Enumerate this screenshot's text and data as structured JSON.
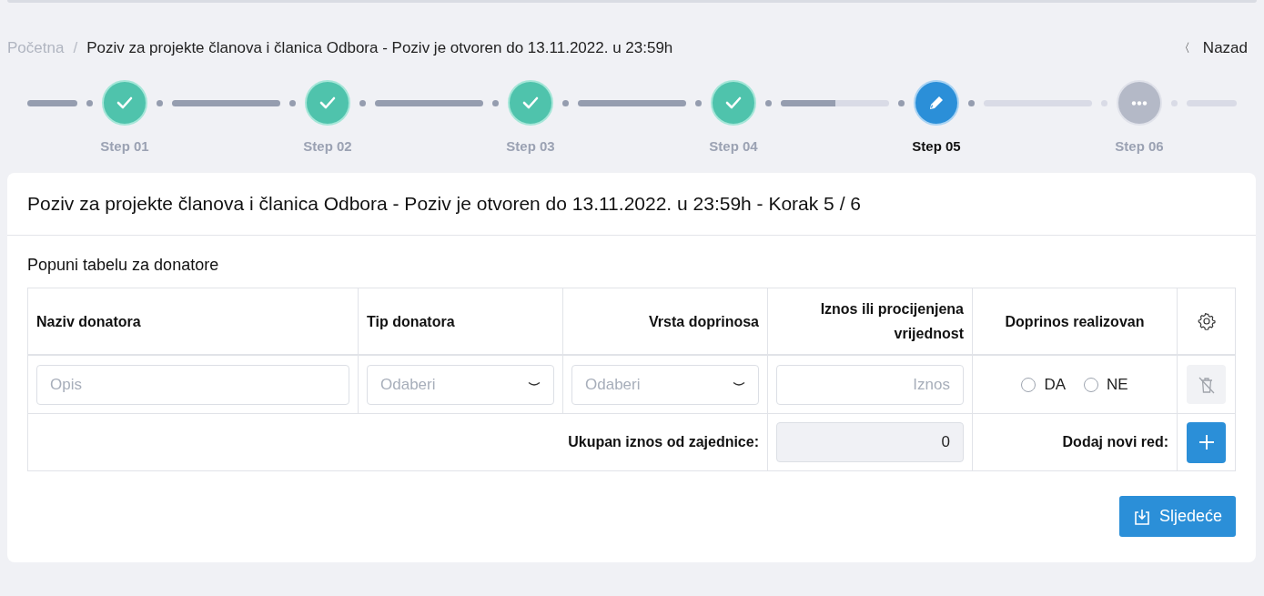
{
  "breadcrumb": {
    "items": [
      {
        "label": "Početna",
        "current": false
      },
      {
        "label": "Poziv za projekte članova i članica Odbora - Poziv je otvoren do 13.11.2022. u 23:59h",
        "current": true
      }
    ],
    "separator": "/",
    "back": {
      "icon": "〈",
      "label": "Nazad"
    }
  },
  "stepper": {
    "steps": [
      {
        "label": "Step 01",
        "kind": "done"
      },
      {
        "label": "Step 02",
        "kind": "done"
      },
      {
        "label": "Step 03",
        "kind": "done"
      },
      {
        "label": "Step 04",
        "kind": "done"
      },
      {
        "label": "Step 05",
        "kind": "current"
      },
      {
        "label": "Step 06",
        "kind": "pending"
      }
    ],
    "connectors": [
      {
        "level": 1
      },
      {
        "level": 1
      },
      {
        "level": 1
      },
      {
        "level": 1
      },
      {
        "level": 0.5
      },
      {
        "level": 0
      },
      {
        "level": 0
      }
    ]
  },
  "card": {
    "title": "Poziv za projekte članova i članica Odbora - Poziv je otvoren do 13.11.2022. u 23:59h - Korak 5 / 6",
    "subtitle": "Popuni tabelu za donatore",
    "table": {
      "columns": [
        {
          "label": "Naziv donatora"
        },
        {
          "label": "Tip donatora"
        },
        {
          "label": "Vrsta doprinosa"
        },
        {
          "label": "Iznos ili procijenjena vrijednost"
        },
        {
          "label": "Doprinos realizovan"
        },
        {
          "kind": "settings"
        }
      ],
      "rows": [
        [
          {
            "kind": "text",
            "placeholder": "Opis"
          },
          {
            "kind": "select",
            "placeholder": "Odaberi"
          },
          {
            "kind": "select",
            "placeholder": "Odaberi"
          },
          {
            "kind": "number",
            "placeholder": "Iznos"
          },
          {
            "kind": "radio",
            "options": [
              {
                "label": "DA",
                "selected": false
              },
              {
                "label": "NE",
                "selected": false
              }
            ]
          },
          {
            "kind": "delete",
            "disabled": true
          }
        ]
      ],
      "footer": {
        "total_label": "Ukupan iznos od zajednice:",
        "total_value": "0",
        "add_label": "Dodaj novi red:"
      }
    },
    "next_button": "Sljedeće"
  }
}
